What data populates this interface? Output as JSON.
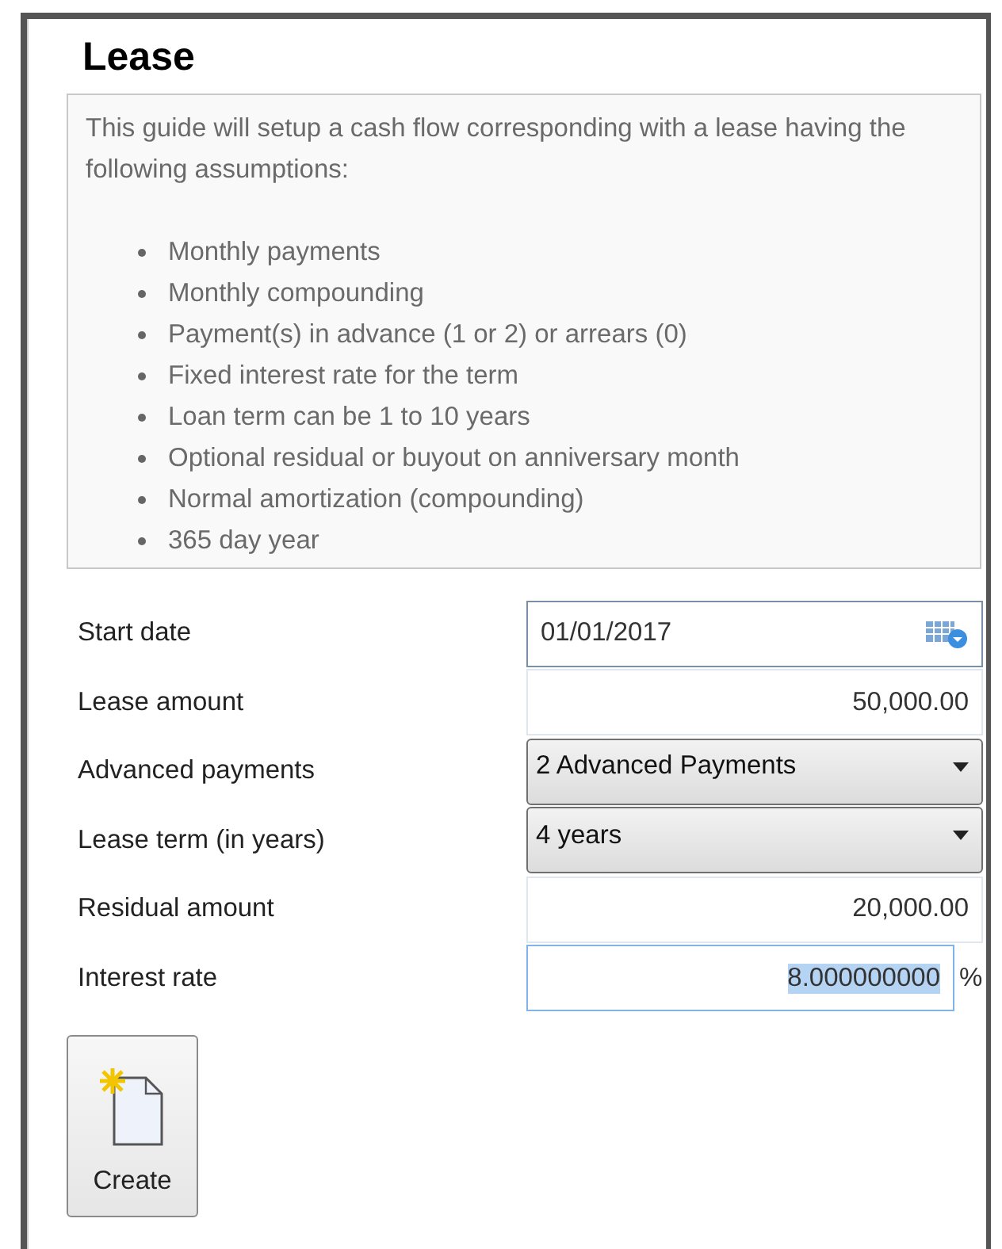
{
  "title": "Lease",
  "intro": "This guide will setup a cash flow corresponding with a lease having the following assumptions:",
  "assumptions": [
    "Monthly payments",
    "Monthly compounding",
    "Payment(s) in advance (1 or 2) or arrears (0)",
    "Fixed interest rate for the term",
    "Loan term can be 1 to 10 years",
    "Optional residual or buyout on anniversary month",
    "Normal amortization (compounding)",
    "365 day year"
  ],
  "fields": [
    {
      "label": "Start date",
      "kind": "date",
      "value": "01/01/2017"
    },
    {
      "label": "Lease amount",
      "kind": "number",
      "value": "50,000.00"
    },
    {
      "label": "Advanced payments",
      "kind": "dropdown",
      "value": "2 Advanced Payments"
    },
    {
      "label": "Lease term (in years)",
      "kind": "dropdown",
      "value": "4 years"
    },
    {
      "label": "Residual amount",
      "kind": "number",
      "value": "20,000.00"
    },
    {
      "label": "Interest rate",
      "kind": "percent",
      "value": "8.000000000",
      "suffix": "%",
      "focused": true
    }
  ],
  "create_button": {
    "label": "Create"
  }
}
